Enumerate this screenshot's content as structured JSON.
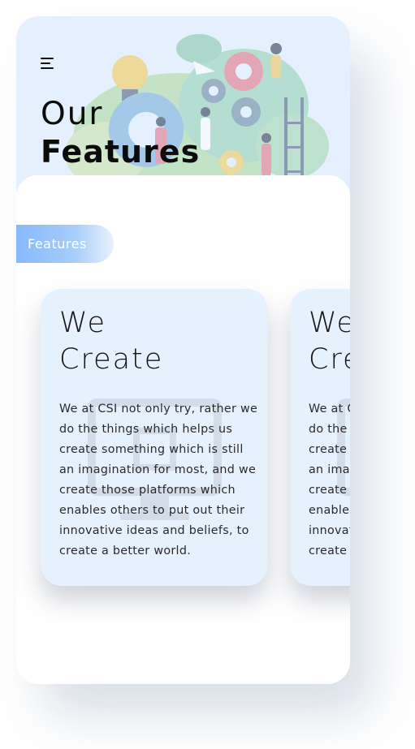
{
  "header": {
    "menu_icon": "hamburger-menu-icon",
    "title_line1": "Our",
    "title_line2": "Features"
  },
  "section": {
    "tag_label": "Features"
  },
  "cards": [
    {
      "title_line1": "We",
      "title_line2": "Create",
      "body": "We at CSI not only try, rather we do the things which helps us create something which is still an imagination for most, and we create those platforms which enables others to put out their innovative ideas and beliefs, to create a better world.",
      "watermark_icon": "monitor-icon"
    },
    {
      "title_line1": "We",
      "title_line2": "Create",
      "body": "We at CSI not only try, rather we do the things which helps us create something which is still an imagination for most, and we create those platforms which enables others to put out their innovative ideas and beliefs, to create a better world.",
      "watermark_icon": "monitor-icon"
    }
  ],
  "colors": {
    "hero_bg": "#e4f0fd",
    "card_bg": "#e6f1fe",
    "pill_gradient_start": "#86b9fb"
  }
}
